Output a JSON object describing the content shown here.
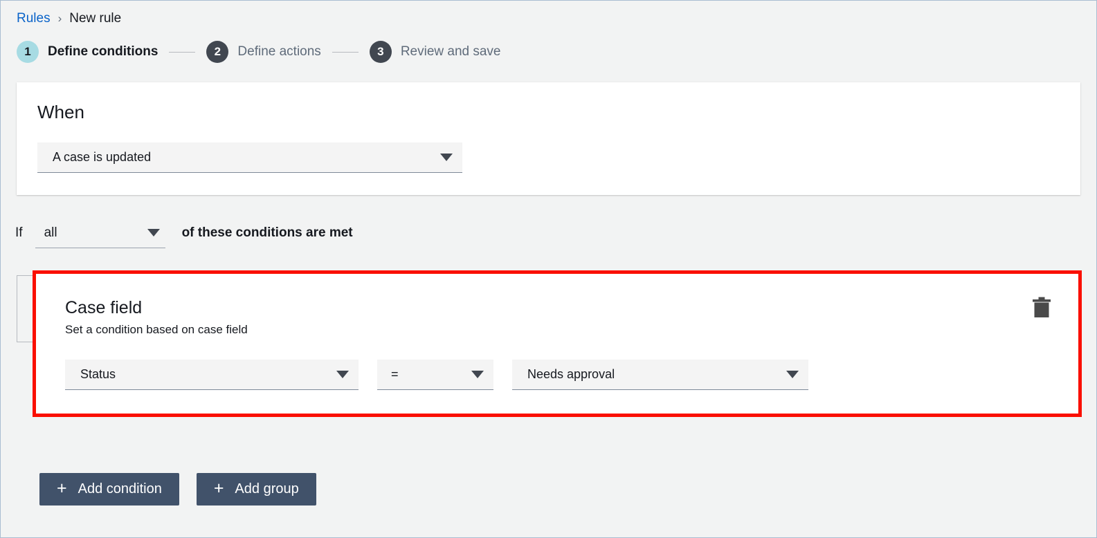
{
  "breadcrumb": {
    "root_label": "Rules",
    "separator": "›",
    "current_label": "New rule"
  },
  "stepper": {
    "steps": [
      {
        "number": "1",
        "label": "Define conditions",
        "state": "active"
      },
      {
        "number": "2",
        "label": "Define actions",
        "state": "inactive"
      },
      {
        "number": "3",
        "label": "Review and save",
        "state": "inactive"
      }
    ]
  },
  "when_card": {
    "title": "When",
    "trigger_select": {
      "value": "A case is updated",
      "icon": "chevron-down-icon"
    }
  },
  "if_row": {
    "prefix": "If",
    "match_select": {
      "value": "all",
      "icon": "chevron-down-icon"
    },
    "suffix": "of these conditions are met"
  },
  "condition": {
    "title": "Case field",
    "description": "Set a condition based on case field",
    "field_select": {
      "value": "Status",
      "icon": "chevron-down-icon"
    },
    "operator_select": {
      "value": "=",
      "icon": "chevron-down-icon"
    },
    "value_select": {
      "value": "Needs approval",
      "icon": "chevron-down-icon"
    },
    "delete_icon": "trash-icon"
  },
  "actions": {
    "add_condition_label": "Add condition",
    "add_group_label": "Add group",
    "plus_glyph": "+"
  },
  "colors": {
    "page_background": "#f2f3f3",
    "card_background": "#ffffff",
    "accent_link": "#0a63c9",
    "step_active": "#a7dbe3",
    "step_inactive": "#414750",
    "button_primary": "#41526a",
    "highlight_border": "#fa0f00",
    "text_primary": "#16191f",
    "text_secondary": "#5f6b7a"
  }
}
